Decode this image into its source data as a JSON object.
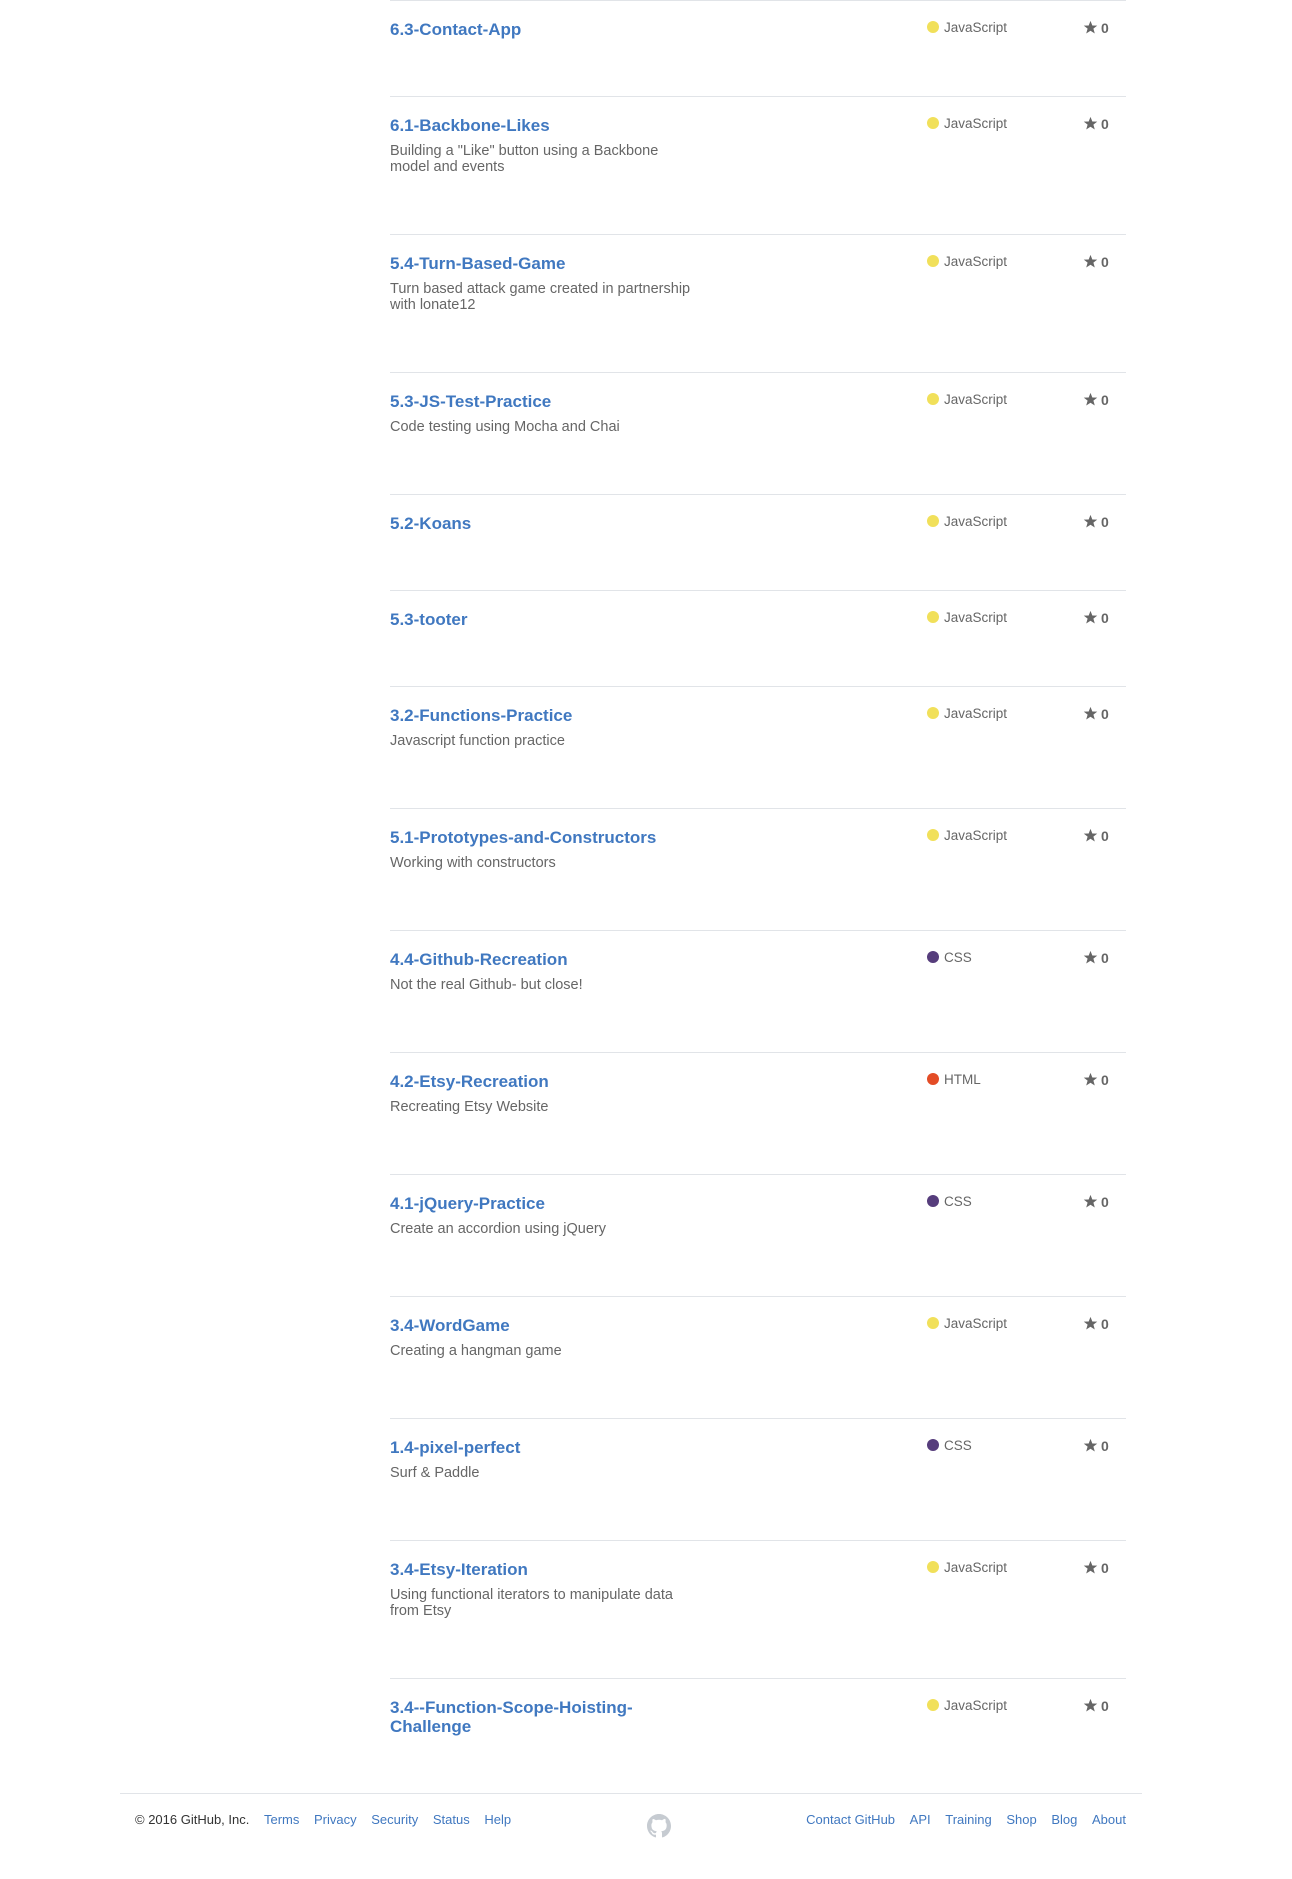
{
  "repos": [
    {
      "name": "6.3-Contact-App",
      "desc": "",
      "lang": "JavaScript",
      "color": "#f1e05a",
      "stars": "0"
    },
    {
      "name": "6.1-Backbone-Likes",
      "desc": "Building a \"Like\" button using a Backbone model and events",
      "lang": "JavaScript",
      "color": "#f1e05a",
      "stars": "0"
    },
    {
      "name": "5.4-Turn-Based-Game",
      "desc": "Turn based attack game created in partnership with lonate12",
      "lang": "JavaScript",
      "color": "#f1e05a",
      "stars": "0"
    },
    {
      "name": "5.3-JS-Test-Practice",
      "desc": "Code testing using Mocha and Chai",
      "lang": "JavaScript",
      "color": "#f1e05a",
      "stars": "0"
    },
    {
      "name": "5.2-Koans",
      "desc": "",
      "lang": "JavaScript",
      "color": "#f1e05a",
      "stars": "0"
    },
    {
      "name": "5.3-tooter",
      "desc": "",
      "lang": "JavaScript",
      "color": "#f1e05a",
      "stars": "0"
    },
    {
      "name": "3.2-Functions-Practice",
      "desc": "Javascript function practice",
      "lang": "JavaScript",
      "color": "#f1e05a",
      "stars": "0"
    },
    {
      "name": "5.1-Prototypes-and-Constructors",
      "desc": "Working with constructors",
      "lang": "JavaScript",
      "color": "#f1e05a",
      "stars": "0"
    },
    {
      "name": "4.4-Github-Recreation",
      "desc": "Not the real Github- but close!",
      "lang": "CSS",
      "color": "#563d7c",
      "stars": "0"
    },
    {
      "name": "4.2-Etsy-Recreation",
      "desc": "Recreating Etsy Website",
      "lang": "HTML",
      "color": "#e34c26",
      "stars": "0"
    },
    {
      "name": "4.1-jQuery-Practice",
      "desc": "Create an accordion using jQuery",
      "lang": "CSS",
      "color": "#563d7c",
      "stars": "0"
    },
    {
      "name": "3.4-WordGame",
      "desc": "Creating a hangman game",
      "lang": "JavaScript",
      "color": "#f1e05a",
      "stars": "0"
    },
    {
      "name": "1.4-pixel-perfect",
      "desc": "Surf & Paddle",
      "lang": "CSS",
      "color": "#563d7c",
      "stars": "0"
    },
    {
      "name": "3.4-Etsy-Iteration",
      "desc": "Using functional iterators to manipulate data from Etsy",
      "lang": "JavaScript",
      "color": "#f1e05a",
      "stars": "0"
    },
    {
      "name": "3.4--Function-Scope-Hoisting-Challenge",
      "desc": "",
      "lang": "JavaScript",
      "color": "#f1e05a",
      "stars": "0"
    }
  ],
  "footer": {
    "copyright": "© 2016 GitHub, Inc.",
    "left_links": [
      "Terms",
      "Privacy",
      "Security",
      "Status",
      "Help"
    ],
    "right_links": [
      "Contact GitHub",
      "API",
      "Training",
      "Shop",
      "Blog",
      "About"
    ],
    "logo_icon": "github-octocat-icon"
  }
}
